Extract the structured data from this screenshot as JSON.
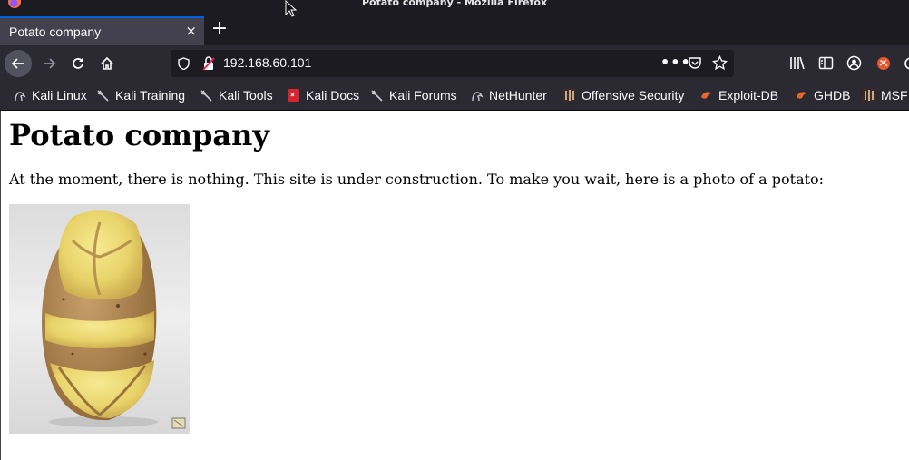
{
  "window": {
    "title": "Potato company - Mozilla Firefox"
  },
  "tabs": [
    {
      "label": "Potato company",
      "close": "×"
    }
  ],
  "new_tab": "+",
  "navbar": {
    "url": "192.168.60.101"
  },
  "bookmarks": [
    {
      "label": "Kali Linux",
      "icon": "kali-dragon-icon"
    },
    {
      "label": "Kali Training",
      "icon": "kali-dragon-icon"
    },
    {
      "label": "Kali Tools",
      "icon": "kali-dragon-icon"
    },
    {
      "label": "Kali Docs",
      "icon": "kali-docs-icon"
    },
    {
      "label": "Kali Forums",
      "icon": "kali-dragon-icon"
    },
    {
      "label": "NetHunter",
      "icon": "kali-dragon-icon"
    },
    {
      "label": "Offensive Security",
      "icon": "offsec-icon"
    },
    {
      "label": "Exploit-DB",
      "icon": "exploitdb-icon"
    },
    {
      "label": "GHDB",
      "icon": "exploitdb-icon"
    },
    {
      "label": "MSF",
      "icon": "offsec-icon"
    }
  ],
  "page": {
    "heading": "Potato company",
    "text": "At the moment, there is nothing. This site is under construction. To make you wait, here is a photo of a potato:"
  },
  "colors": {
    "accent": "#0060df",
    "toolbar": "#2b2a33",
    "titlebar": "#1c1b22",
    "tab_active": "#42414d"
  }
}
